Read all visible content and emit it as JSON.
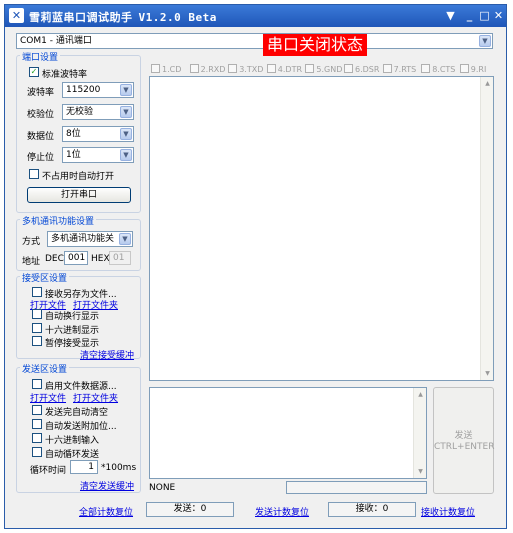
{
  "titlebar": {
    "title": "雪莉蓝串口调试助手",
    "version": "V1.2.0 Beta",
    "menu_glyph": "▼",
    "min_glyph": "_",
    "max_glyph": "□",
    "close_glyph": "✕",
    "logo_glyph": "✕"
  },
  "port_select": {
    "value": "COM1 - 通讯端口"
  },
  "port_settings": {
    "group_label": "端口设置",
    "std_baud_label": "标准波特率",
    "baud_label": "波特率",
    "baud_value": "115200",
    "parity_label": "校验位",
    "parity_value": "无校验",
    "databits_label": "数据位",
    "databits_value": "8位",
    "stopbits_label": "停止位",
    "stopbits_value": "1位",
    "auto_open_label": "不占用时自动打开",
    "open_button": "打开串口"
  },
  "multi": {
    "group_label": "多机通讯功能设置",
    "mode_label": "方式",
    "mode_value": "多机通讯功能关",
    "addr_label": "地址",
    "dec_label": "DEC",
    "dec_value": "001",
    "hex_label": "HEX",
    "hex_value": "01"
  },
  "receive": {
    "group_label": "接受区设置",
    "save_file_label": "接收另存为文件...",
    "open_file_link": "打开文件",
    "open_folder_link": "打开文件夹",
    "auto_wrap_label": "自动换行显示",
    "hex_display_label": "十六进制显示",
    "pause_label": "暂停接受显示",
    "clear_link": "清空接受缓冲"
  },
  "send": {
    "group_label": "发送区设置",
    "file_source_label": "启用文件数据源...",
    "open_file_link": "打开文件",
    "open_folder_link": "打开文件夹",
    "auto_clear_label": "发送完自动清空",
    "auto_append_label": "自动发送附加位...",
    "hex_input_label": "十六进制输入",
    "auto_loop_label": "自动循环发送",
    "cycle_label": "循环时间",
    "cycle_value": "1",
    "cycle_unit": "*100ms",
    "clear_link": "清空发送缓冲"
  },
  "status_title": "串口关闭状态",
  "signals": [
    "1.CD",
    "2.RXD",
    "3.TXD",
    "4.DTR",
    "5.GND",
    "6.DSR",
    "7.RTS",
    "8.CTS",
    "9.RI"
  ],
  "send_button": {
    "line1": "发送",
    "line2": "CTRL+ENTER"
  },
  "status_none": "NONE",
  "bottom": {
    "reset_all_link": "全部计数复位",
    "send_count": "发送：0",
    "reset_send_link": "发送计数复位",
    "recv_count": "接收：0",
    "reset_recv_link": "接收计数复位"
  },
  "colors": {
    "title_bar": "#1f56b8",
    "status_red": "#ff0000",
    "group_label": "#0046d5",
    "link": "#0000e0"
  }
}
